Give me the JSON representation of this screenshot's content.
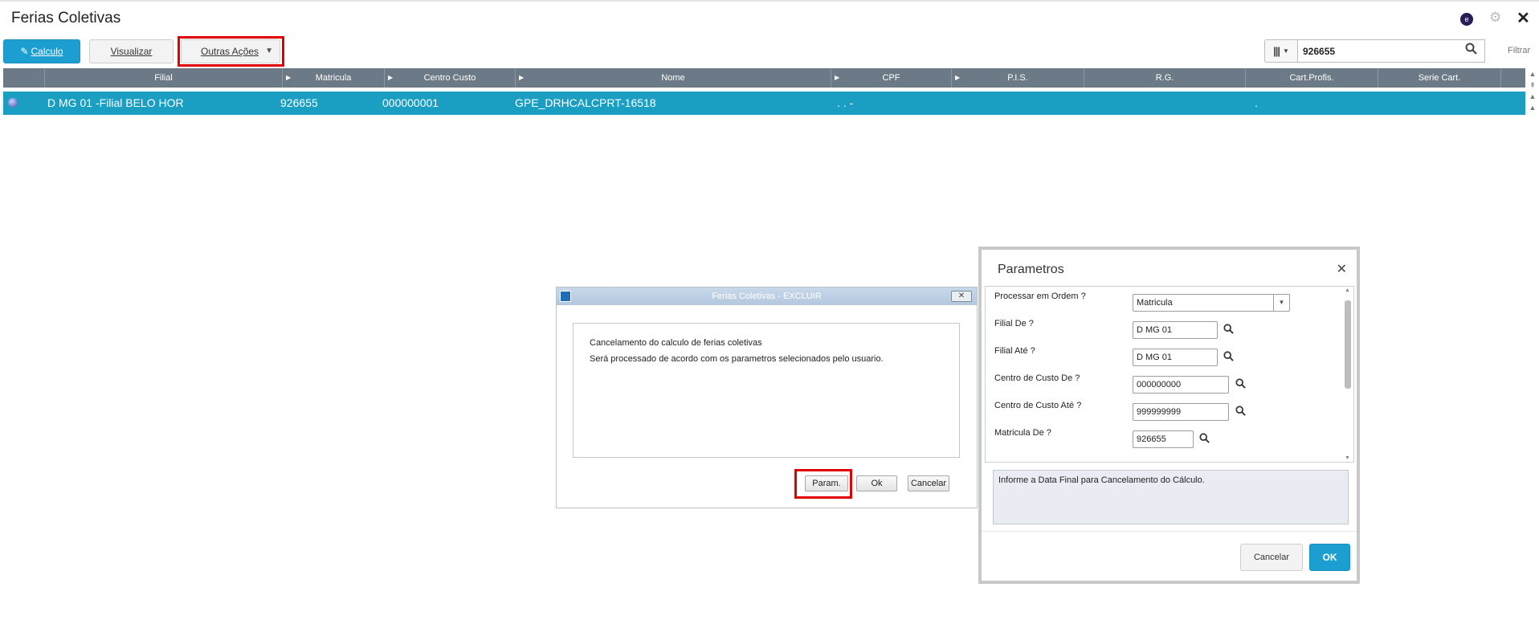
{
  "app": {
    "title": "Ferias Coletivas"
  },
  "toolbar": {
    "calculo_label": "Calculo",
    "visualizar_label": "Visualizar",
    "outras_label": "Outras Ações",
    "search_value": "926655",
    "filtrar_label": "Filtrar"
  },
  "grid": {
    "columns": [
      "Filial",
      "Matricula",
      "Centro Custo",
      "Nome",
      "CPF",
      "P.I.S.",
      "R.G.",
      "Cart.Profis.",
      "Serie Cart."
    ],
    "row": {
      "filial": "D MG 01 -Filial BELO HOR",
      "matricula": "926655",
      "centro_custo": "000000001",
      "nome": "GPE_DRHCALCPRT-16518",
      "cpf": ". . -",
      "cart_profis": "."
    }
  },
  "ferias_dialog": {
    "title": "Ferias Coletivas - EXCLUIR",
    "line1": "Cancelamento do calculo de ferias coletivas",
    "line2": "Será processado de acordo com os parametros selecionados pelo usuario.",
    "param_btn": "Param.",
    "ok_btn": "Ok",
    "cancel_btn": "Cancelar"
  },
  "param_dialog": {
    "title": "Parametros",
    "fields": [
      {
        "label": "Processar em Ordem ?",
        "value": "Matricula"
      },
      {
        "label": "Filial De ?",
        "value": "D MG 01"
      },
      {
        "label": "Filial Até ?",
        "value": "D MG 01"
      },
      {
        "label": "Centro de Custo De ?",
        "value": "000000000"
      },
      {
        "label": "Centro de Custo Até ?",
        "value": "999999999"
      },
      {
        "label": "Matricula De ?",
        "value": "926655"
      }
    ],
    "help_text": "Informe a Data Final para Cancelamento do Cálculo.",
    "cancel_btn": "Cancelar",
    "ok_btn": "OK"
  }
}
